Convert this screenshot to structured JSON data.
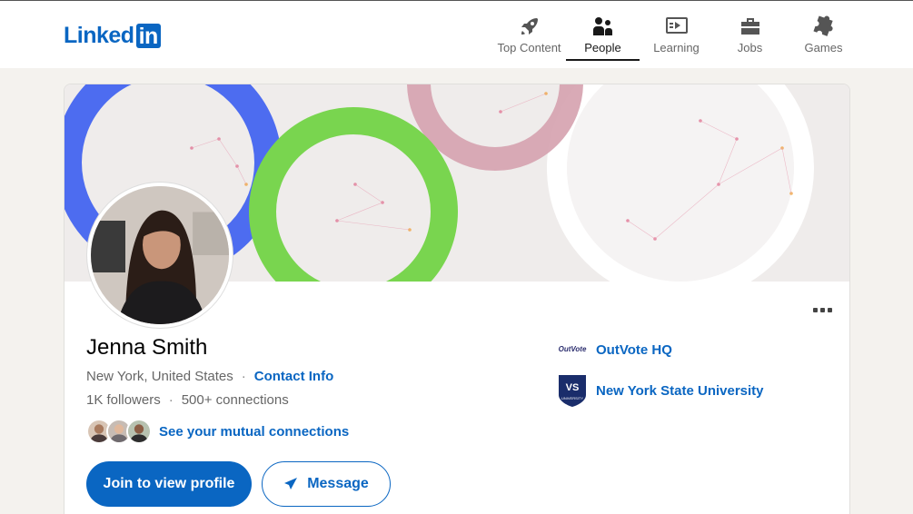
{
  "logo": {
    "text": "Linked",
    "box": "in"
  },
  "nav": [
    {
      "label": "Top Content",
      "icon": "rocket-icon"
    },
    {
      "label": "People",
      "icon": "people-icon",
      "active": true
    },
    {
      "label": "Learning",
      "icon": "play-video-icon"
    },
    {
      "label": "Jobs",
      "icon": "briefcase-icon"
    },
    {
      "label": "Games",
      "icon": "puzzle-icon"
    }
  ],
  "profile": {
    "name": "Jenna Smith",
    "location": "New York, United States",
    "separator": "·",
    "contact_label": "Contact Info",
    "followers": "1K followers",
    "connections": "500+ connections",
    "mutual_label": "See your mutual connections"
  },
  "actions": {
    "join_label": "Join to view profile",
    "message_label": "Message"
  },
  "orgs": [
    {
      "name": "OutVote HQ",
      "logo_text": "OutVote"
    },
    {
      "name": "New York State University",
      "logo_text": "UNIVERSITY"
    }
  ],
  "colors": {
    "brand": "#0a66c2",
    "banner_blue": "#4d6cf0",
    "banner_green": "#79d54f",
    "banner_pink": "#d6a3b0"
  }
}
